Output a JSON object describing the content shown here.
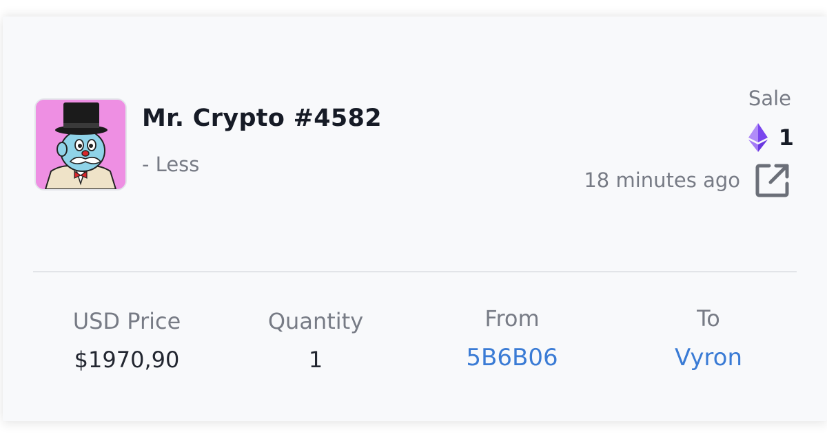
{
  "item": {
    "title": "Mr. Crypto #4582",
    "subtitle": "- Less",
    "thumbnail_icon": "mr-crypto-avatar"
  },
  "sale": {
    "label": "Sale",
    "currency_icon": "ethereum-icon",
    "amount": "1",
    "time_ago": "18 minutes ago",
    "link_icon": "external-link-icon"
  },
  "stats": {
    "usd_price": {
      "label": "USD Price",
      "value": "$1970,90"
    },
    "quantity": {
      "label": "Quantity",
      "value": "1"
    },
    "from": {
      "label": "From",
      "value": "5B6B06"
    },
    "to": {
      "label": "To",
      "value": "Vyron"
    }
  },
  "colors": {
    "link": "#3a7bd5",
    "muted_text": "#777b85",
    "primary_text": "#161b26",
    "thumbnail_bg": "#ee8fe3",
    "eth_purple": "#8a5cf6"
  }
}
